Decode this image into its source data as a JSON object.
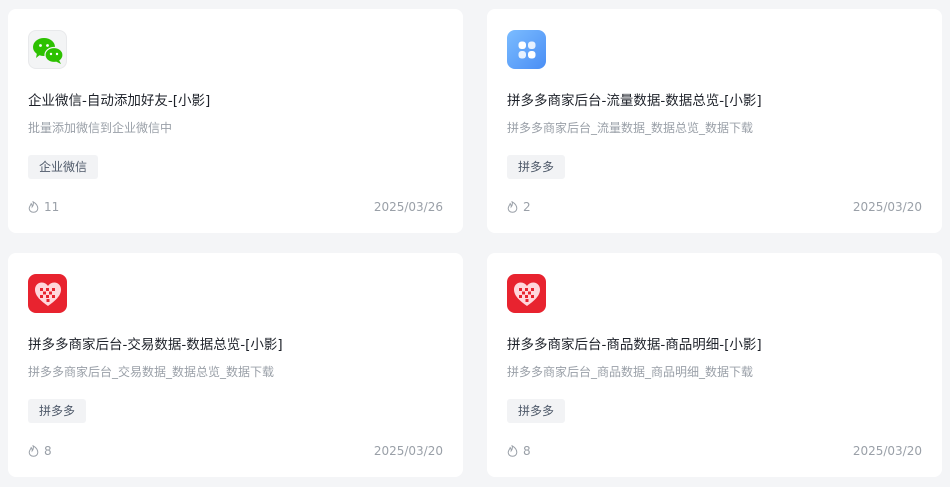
{
  "cards": [
    {
      "icon": "wechat-icon",
      "title": "企业微信-自动添加好友-[小影]",
      "description": "批量添加微信到企业微信中",
      "tag": "企业微信",
      "hot_count": "11",
      "date": "2025/03/26"
    },
    {
      "icon": "apps-grid-icon",
      "title": "拼多多商家后台-流量数据-数据总览-[小影]",
      "description": "拼多多商家后台_流量数据_数据总览_数据下载",
      "tag": "拼多多",
      "hot_count": "2",
      "date": "2025/03/20"
    },
    {
      "icon": "pinduoduo-logo-icon",
      "title": "拼多多商家后台-交易数据-数据总览-[小影]",
      "description": "拼多多商家后台_交易数据_数据总览_数据下载",
      "tag": "拼多多",
      "hot_count": "8",
      "date": "2025/03/20"
    },
    {
      "icon": "pinduoduo-logo-icon",
      "title": "拼多多商家后台-商品数据-商品明细-[小影]",
      "description": "拼多多商家后台_商品数据_商品明细_数据下载",
      "tag": "拼多多",
      "hot_count": "8",
      "date": "2025/03/20"
    }
  ],
  "colors": {
    "page_background": "#f4f5f7",
    "card_background": "#ffffff",
    "pinduoduo_red": "#e8232f",
    "wechat_green": "#2dc100",
    "apps_blue": "#4a8ef5"
  }
}
